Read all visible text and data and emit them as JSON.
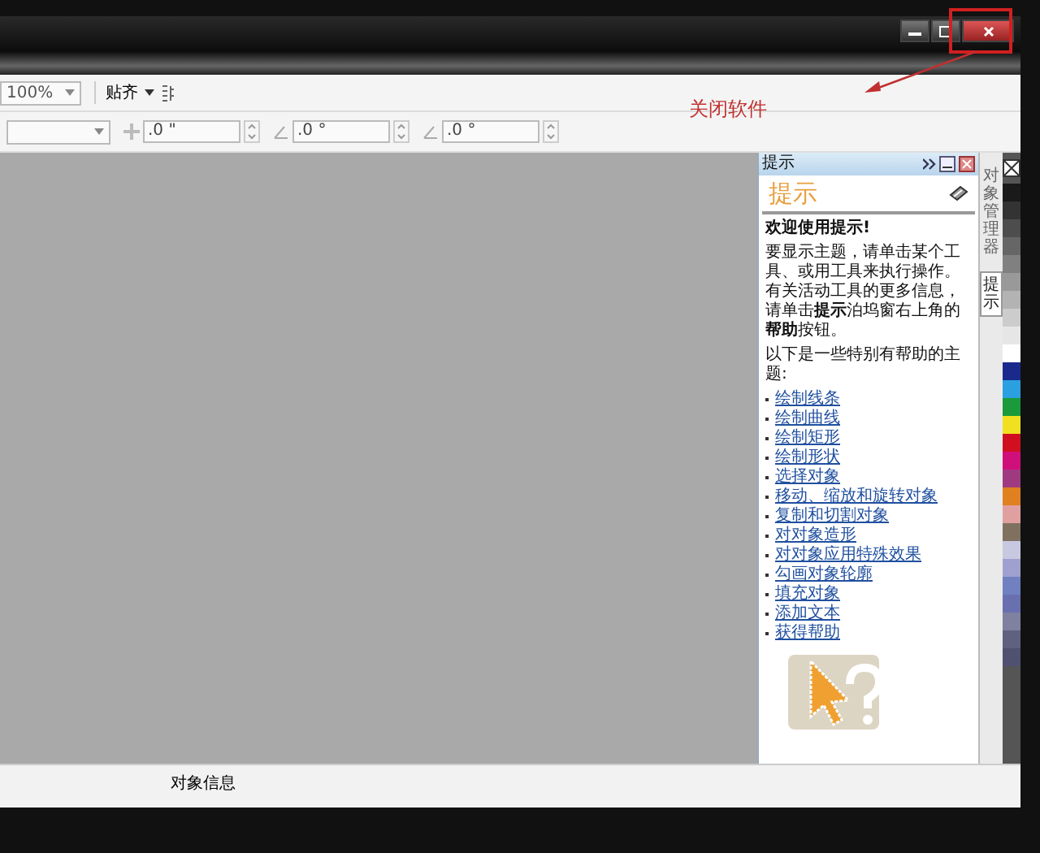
{
  "toolbar": {
    "zoom": "100%",
    "snap": "贴齐"
  },
  "property_bar": {
    "fields": [
      {
        "value": ".0 \""
      },
      {
        "value": ".0 °"
      },
      {
        "value": ".0 °"
      }
    ]
  },
  "docker": {
    "title": "提示",
    "header": "提示",
    "heading": "欢迎使用提示!",
    "intro": "要显示主题，请单击某个工具、或用工具来执行操作。有关活动工具的更多信息，请单击**提示**泊坞窗右上角的**帮助**按钮。",
    "topics_label": "以下是一些特别有帮助的主题:",
    "links": [
      "绘制线条",
      "绘制曲线",
      "绘制矩形",
      "绘制形状",
      "选择对象",
      "移动、缩放和旋转对象",
      "复制和切割对象",
      "对对象造形",
      "对对象应用特殊效果",
      "勾画对象轮廓",
      "填充对象",
      "添加文本",
      "获得帮助"
    ]
  },
  "side_tabs": [
    {
      "label": "对象管理器",
      "selected": false
    },
    {
      "label": "提示",
      "selected": true
    }
  ],
  "palette": [
    {
      "color": "#1a1a1a"
    },
    {
      "color": "#333333"
    },
    {
      "color": "#4d4d4d"
    },
    {
      "color": "#666666"
    },
    {
      "color": "#808080"
    },
    {
      "color": "#999999"
    },
    {
      "color": "#b3b3b3"
    },
    {
      "color": "#cccccc"
    },
    {
      "color": "#e6e6e6"
    },
    {
      "color": "#ffffff"
    },
    {
      "color": "#1a2a8c"
    },
    {
      "color": "#2aa0e0"
    },
    {
      "color": "#1a9a3a"
    },
    {
      "color": "#f0e020"
    },
    {
      "color": "#d01020"
    },
    {
      "color": "#d0107a"
    },
    {
      "color": "#a03a80"
    },
    {
      "color": "#e08020"
    },
    {
      "color": "#e0a0a0"
    },
    {
      "color": "#807060"
    },
    {
      "color": "#c8c8e0"
    },
    {
      "color": "#a0a0d0"
    },
    {
      "color": "#7080c0"
    },
    {
      "color": "#6870b0"
    },
    {
      "color": "#8080a0"
    },
    {
      "color": "#606080"
    },
    {
      "color": "#505070"
    }
  ],
  "status_bar": {
    "text": "对象信息"
  },
  "annotation": {
    "text": "关闭软件"
  }
}
